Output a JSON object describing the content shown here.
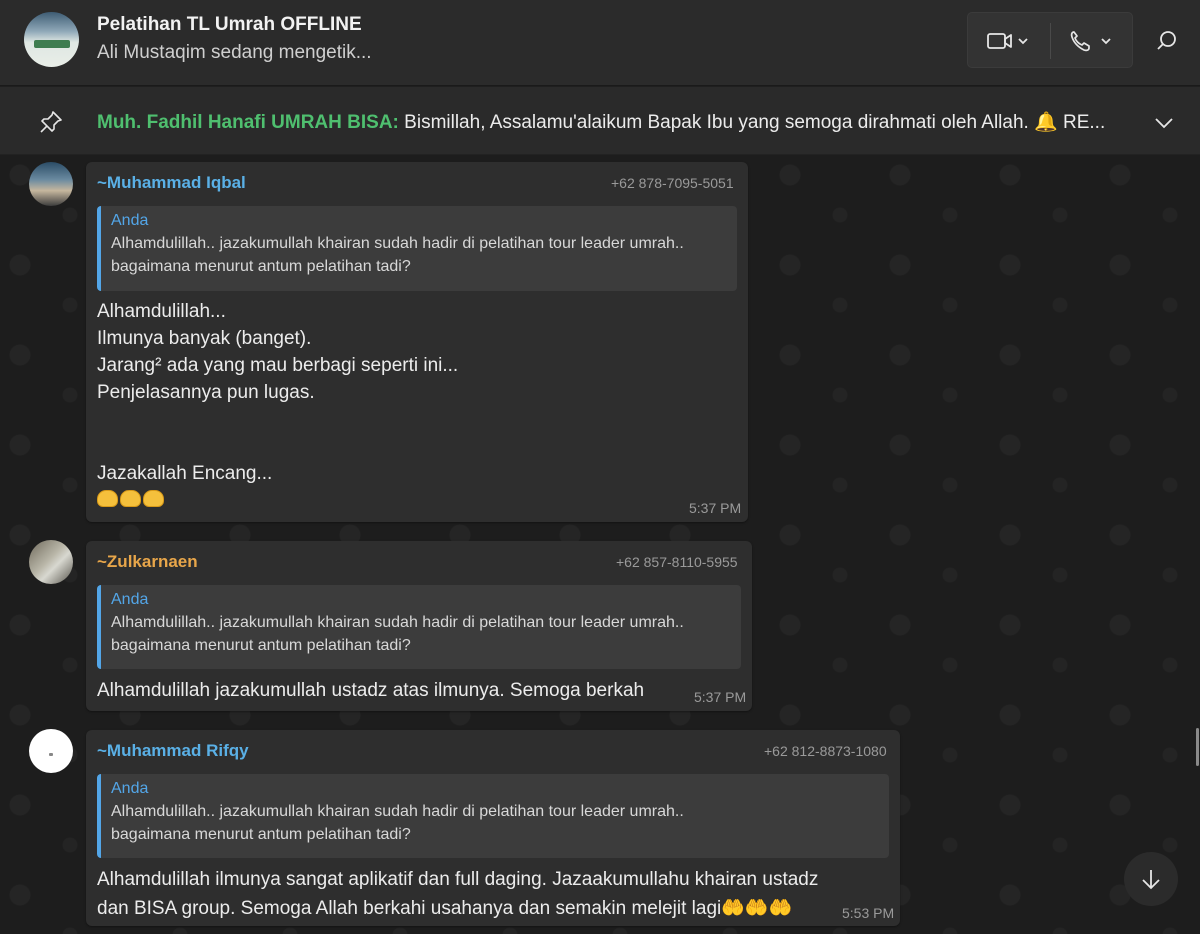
{
  "header": {
    "title": "Pelatihan TL Umrah OFFLINE",
    "status": "Ali Mustaqim sedang mengetik...",
    "video_icon": "video-camera-icon",
    "voice_icon": "phone-icon",
    "search_icon": "search-icon"
  },
  "pinned": {
    "icon": "pin-icon",
    "sender": "Muh. Fadhil Hanafi UMRAH BISA:",
    "text": " Bismillah, Assalamu'alaikum Bapak Ibu yang semoga dirahmati oleh Allah. 🔔 RE..."
  },
  "messages": [
    {
      "sender": "~Muhammad Iqbal",
      "sender_color": "#5ab0e6",
      "phone": "+62 878-7095-5051",
      "quote": {
        "author": "Anda",
        "line1": "Alhamdulillah.. jazakumullah khairan sudah hadir di pelatihan tour leader umrah..",
        "line2": "bagaimana menurut antum pelatihan tadi?"
      },
      "lines": [
        "Alhamdulillah...",
        "Ilmunya banyak (banget).",
        "Jarang² ada yang mau berbagi seperti ini...",
        "Penjelasannya pun lugas.",
        "",
        "",
        "Jazakallah Encang..."
      ],
      "emoji": "🤲🤲🤲",
      "time": "5:37 PM"
    },
    {
      "sender": "~Zulkarnaen",
      "sender_color": "#e8a64a",
      "phone": "+62 857-8110-5955",
      "quote": {
        "author": "Anda",
        "line1": "Alhamdulillah.. jazakumullah khairan sudah hadir di pelatihan tour leader umrah..",
        "line2": "bagaimana menurut antum pelatihan tadi?"
      },
      "lines": [
        "Alhamdulillah jazakumullah ustadz atas ilmunya. Semoga berkah"
      ],
      "time": "5:37 PM"
    },
    {
      "sender": "~Muhammad Rifqy",
      "sender_color": "#5ab0e6",
      "phone": "+62 812-8873-1080",
      "quote": {
        "author": "Anda",
        "line1": "Alhamdulillah.. jazakumullah khairan sudah hadir di pelatihan tour leader umrah..",
        "line2": "bagaimana menurut antum pelatihan tadi?"
      },
      "lines": [
        "Alhamdulillah ilmunya sangat aplikatif dan full daging. Jazaakumullahu khairan ustadz",
        "dan BISA group. Semoga Allah berkahi usahanya dan semakin melejit lagi🤲🤲🤲"
      ],
      "time": "5:53 PM"
    }
  ],
  "scroll_down_icon": "arrow-down-icon"
}
